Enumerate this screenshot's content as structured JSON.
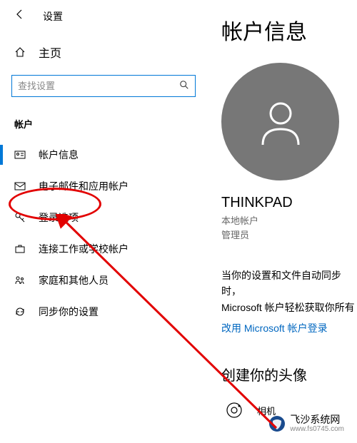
{
  "header": {
    "title": "设置"
  },
  "home": {
    "label": "主页"
  },
  "search": {
    "placeholder": "查找设置"
  },
  "section": {
    "label": "帐户"
  },
  "nav": {
    "accountInfo": "帐户信息",
    "emailAccounts": "电子邮件和应用帐户",
    "signinOptions": "登录选项",
    "workSchool": "连接工作或学校帐户",
    "family": "家庭和其他人员",
    "sync": "同步你的设置"
  },
  "main": {
    "title": "帐户信息",
    "username": "THINKPAD",
    "accountType1": "本地帐户",
    "accountType2": "管理员",
    "syncLine1": "当你的设置和文件自动同步时，",
    "syncLine2": "Microsoft 帐户轻松获取你所有",
    "msLink": "改用 Microsoft 帐户登录",
    "createAvatarHeading": "创建你的头像",
    "cameraLabel": "相机"
  },
  "watermark": {
    "main": "飞沙系统网",
    "sub": "www.fs0745.com"
  }
}
